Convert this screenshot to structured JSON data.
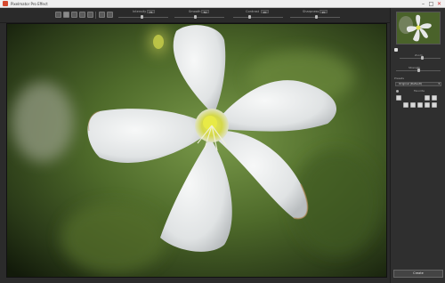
{
  "window": {
    "title": "Pixelmator Pro Effect",
    "controls": [
      "–",
      "□",
      "✕"
    ]
  },
  "toolbar": {
    "tools": [
      {
        "name": "view-original-icon"
      },
      {
        "name": "compare-icon"
      },
      {
        "name": "brush-icon"
      },
      {
        "name": "eraser-icon"
      },
      {
        "name": "settings-icon"
      },
      {
        "name": "grid-icon"
      },
      {
        "name": "zoom-icon"
      }
    ],
    "sliders": [
      {
        "label": "Intensity",
        "value": "75",
        "position": 0.45
      },
      {
        "label": "Smooth",
        "value": "50",
        "position": 0.4
      },
      {
        "label": "Contrast",
        "value": "20",
        "position": 0.3
      },
      {
        "label": "Sharpness",
        "value": "20",
        "position": 0.5
      }
    ]
  },
  "sidebar": {
    "zoom_label": "Zoom",
    "zoom_value": 0.55,
    "strength_label": "Strength",
    "strength_value": 0.5,
    "presets_label": "Presets",
    "presets_selected": "Original (Default)",
    "favorites_label": "Favorite",
    "create_label": "Create"
  },
  "colors": {
    "accent": "#d64a2f",
    "background": "#2b2b2b"
  }
}
